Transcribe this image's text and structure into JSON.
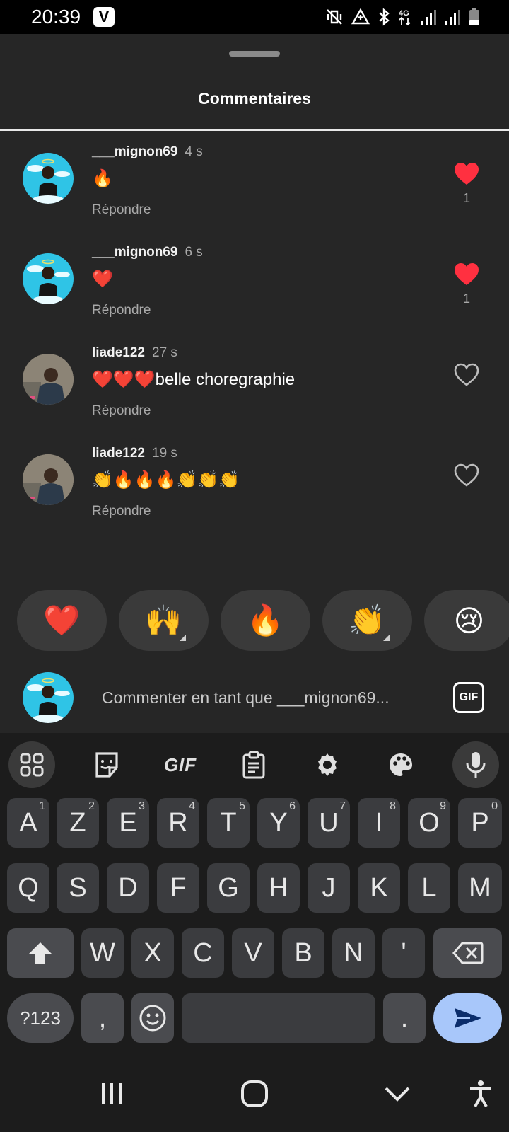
{
  "status_bar": {
    "time": "20:39",
    "carrier_badge": "V",
    "network": "4G",
    "icons": [
      "mute-vibrate-icon",
      "data-saver-icon",
      "bluetooth-icon",
      "4g-icon",
      "signal-icon",
      "signal-icon-2",
      "battery-icon"
    ]
  },
  "sheet": {
    "title": "Commentaires"
  },
  "comments": [
    {
      "user": "___mignon69",
      "time": "4 s",
      "text": "🔥",
      "reply": "Répondre",
      "liked": true,
      "likes": "1"
    },
    {
      "user": "___mignon69",
      "time": "6 s",
      "text": "❤️",
      "reply": "Répondre",
      "liked": true,
      "likes": "1"
    },
    {
      "user": "liade122",
      "time": "27 s",
      "text": "❤️❤️❤️belle choregraphie",
      "reply": "Répondre",
      "liked": false,
      "likes": ""
    },
    {
      "user": "liade122",
      "time": "19 s",
      "text": "👏🔥🔥🔥👏👏👏",
      "reply": "Répondre",
      "liked": false,
      "likes": ""
    }
  ],
  "quick_reactions": [
    "❤️",
    "🙌",
    "🔥",
    "👏",
    "😢"
  ],
  "composer": {
    "placeholder": "Commenter en tant que ___mignon69...",
    "gif_label": "GIF"
  },
  "keyboard": {
    "toolbar_gif": "GIF",
    "row1": [
      [
        "A",
        "1"
      ],
      [
        "Z",
        "2"
      ],
      [
        "E",
        "3"
      ],
      [
        "R",
        "4"
      ],
      [
        "T",
        "5"
      ],
      [
        "Y",
        "6"
      ],
      [
        "U",
        "7"
      ],
      [
        "I",
        "8"
      ],
      [
        "O",
        "9"
      ],
      [
        "P",
        "0"
      ]
    ],
    "row2": [
      "Q",
      "S",
      "D",
      "F",
      "G",
      "H",
      "J",
      "K",
      "L",
      "M"
    ],
    "row3": [
      "W",
      "X",
      "C",
      "V",
      "B",
      "N",
      "'"
    ],
    "symbols_label": "?123",
    "comma": ",",
    "period": "."
  },
  "colors": {
    "sheet_bg": "#262626",
    "heart_red": "#ff3040",
    "send_key": "#a8c7fa",
    "muted_text": "#a8a8a8"
  }
}
